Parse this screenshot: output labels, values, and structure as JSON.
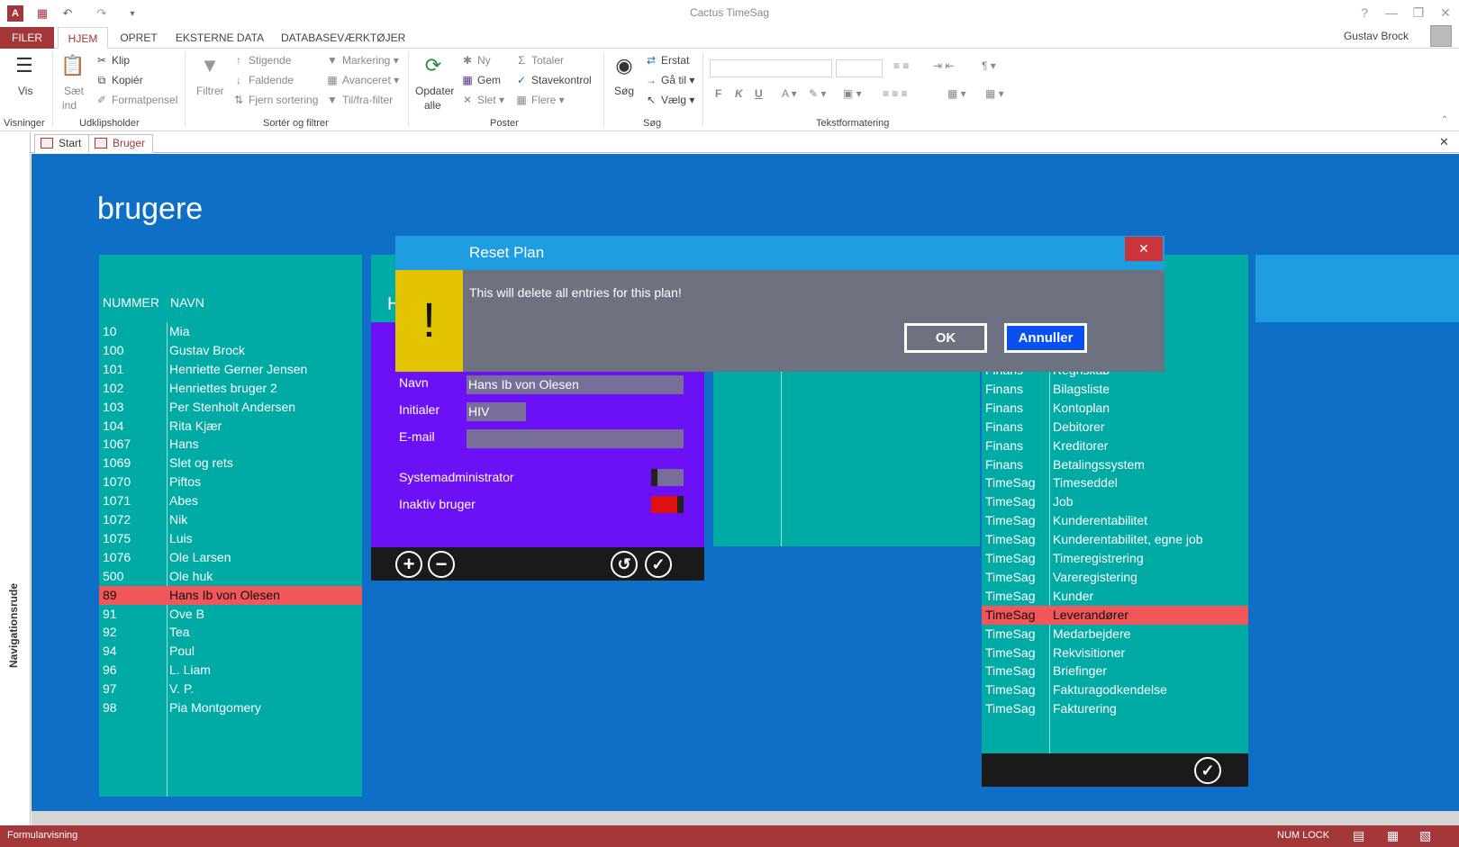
{
  "window": {
    "title": "Cactus TimeSag",
    "user": "Gustav Brock",
    "help": "?"
  },
  "ribbon_tabs": [
    "FILER",
    "HJEM",
    "OPRET",
    "EKSTERNE DATA",
    "DATABASEVÆRKTØJER"
  ],
  "ribbon": {
    "groups": [
      "Visninger",
      "Udklipsholder",
      "Sortér og filtrer",
      "Poster",
      "Søg",
      "Tekstformatering"
    ],
    "vis": "Vis",
    "saet": "Sæt",
    "ind": "ind",
    "klip": "Klip",
    "kopier": "Kopiér",
    "formatpensel": "Formatpensel",
    "filtrer": "Filtrer",
    "stigende": "Stigende",
    "faldende": "Faldende",
    "fjern_sortering": "Fjern sortering",
    "markering": "Markering",
    "avanceret": "Avanceret",
    "tilfra": "Til/fra-filter",
    "opdater": "Opdater",
    "alle": "alle",
    "ny": "Ny",
    "gem": "Gem",
    "slet": "Slet",
    "totaler": "Totaler",
    "stavekontrol": "Stavekontrol",
    "flere": "Flere",
    "sog": "Søg",
    "erstat": "Erstat",
    "gaa_til": "Gå til",
    "vaelg": "Vælg",
    "fmt": [
      "F",
      "K",
      "U"
    ]
  },
  "doc_tabs": [
    "Start",
    "Bruger"
  ],
  "nav_pane": "Navigationsrude",
  "form": {
    "title": "brugere",
    "list_headers": [
      "NUMMER",
      "NAVN"
    ],
    "users": [
      {
        "num": "10",
        "name": "Mia"
      },
      {
        "num": "100",
        "name": "Gustav Brock"
      },
      {
        "num": "101",
        "name": "Henriette Gerner Jensen"
      },
      {
        "num": "102",
        "name": "Henriettes bruger 2"
      },
      {
        "num": "103",
        "name": "Per Stenholt Andersen"
      },
      {
        "num": "104",
        "name": "Rita Kjær"
      },
      {
        "num": "1067",
        "name": "Hans"
      },
      {
        "num": "1069",
        "name": "Slet og rets"
      },
      {
        "num": "1070",
        "name": "Piftos"
      },
      {
        "num": "1071",
        "name": "Abes"
      },
      {
        "num": "1072",
        "name": "Nik"
      },
      {
        "num": "1075",
        "name": "Luis"
      },
      {
        "num": "1076",
        "name": "Ole Larsen"
      },
      {
        "num": "500",
        "name": "Ole huk"
      },
      {
        "num": "89",
        "name": "Hans Ib von Olesen"
      },
      {
        "num": "91",
        "name": "Ove B"
      },
      {
        "num": "92",
        "name": "Tea"
      },
      {
        "num": "94",
        "name": "Poul"
      },
      {
        "num": "96",
        "name": "L. Liam"
      },
      {
        "num": "97",
        "name": "V. P."
      },
      {
        "num": "98",
        "name": "Pia Montgomery"
      }
    ],
    "selected_user_index": 14,
    "detail": {
      "header_letter": "H",
      "navn_label": "Navn",
      "navn_value": "Hans Ib von Olesen",
      "initialer_label": "Initialer",
      "initialer_value": "HIV",
      "email_label": "E-mail",
      "email_value": "",
      "sysadmin_label": "Systemadministrator",
      "inaktiv_label": "Inaktiv bruger"
    },
    "access": [
      {
        "area": "Finans",
        "item": "Regnskab"
      },
      {
        "area": "Finans",
        "item": "Bilagsliste"
      },
      {
        "area": "Finans",
        "item": "Kontoplan"
      },
      {
        "area": "Finans",
        "item": "Debitorer"
      },
      {
        "area": "Finans",
        "item": "Kreditorer"
      },
      {
        "area": "Finans",
        "item": "Betalingssystem"
      },
      {
        "area": "TimeSag",
        "item": "Timeseddel"
      },
      {
        "area": "TimeSag",
        "item": "Job"
      },
      {
        "area": "TimeSag",
        "item": "Kunderentabilitet"
      },
      {
        "area": "TimeSag",
        "item": "Kunderentabilitet, egne job"
      },
      {
        "area": "TimeSag",
        "item": "Timeregistrering"
      },
      {
        "area": "TimeSag",
        "item": "Vareregistering"
      },
      {
        "area": "TimeSag",
        "item": "Kunder"
      },
      {
        "area": "TimeSag",
        "item": "Leverandører"
      },
      {
        "area": "TimeSag",
        "item": "Medarbejdere"
      },
      {
        "area": "TimeSag",
        "item": "Rekvisitioner"
      },
      {
        "area": "TimeSag",
        "item": "Briefinger"
      },
      {
        "area": "TimeSag",
        "item": "Fakturagodkendelse"
      },
      {
        "area": "TimeSag",
        "item": "Fakturering"
      }
    ],
    "selected_access_index": 13
  },
  "dialog": {
    "title": "Reset Plan",
    "icon": "!",
    "message": "This will delete all entries for this plan!",
    "ok": "OK",
    "cancel": "Annuller",
    "close": "✕"
  },
  "status": {
    "left": "Formularvisning",
    "numlock": "NUM LOCK"
  },
  "colors": {
    "access_red": "#a4373a",
    "form_blue": "#0f6fc6",
    "teal": "#00aaa5",
    "purple": "#6c10f5",
    "selected": "#f0565a",
    "dialog_title": "#1e9de0",
    "dialog_body": "#6e7280",
    "warning": "#e2c500",
    "cancel_btn": "#0a4ff0"
  }
}
